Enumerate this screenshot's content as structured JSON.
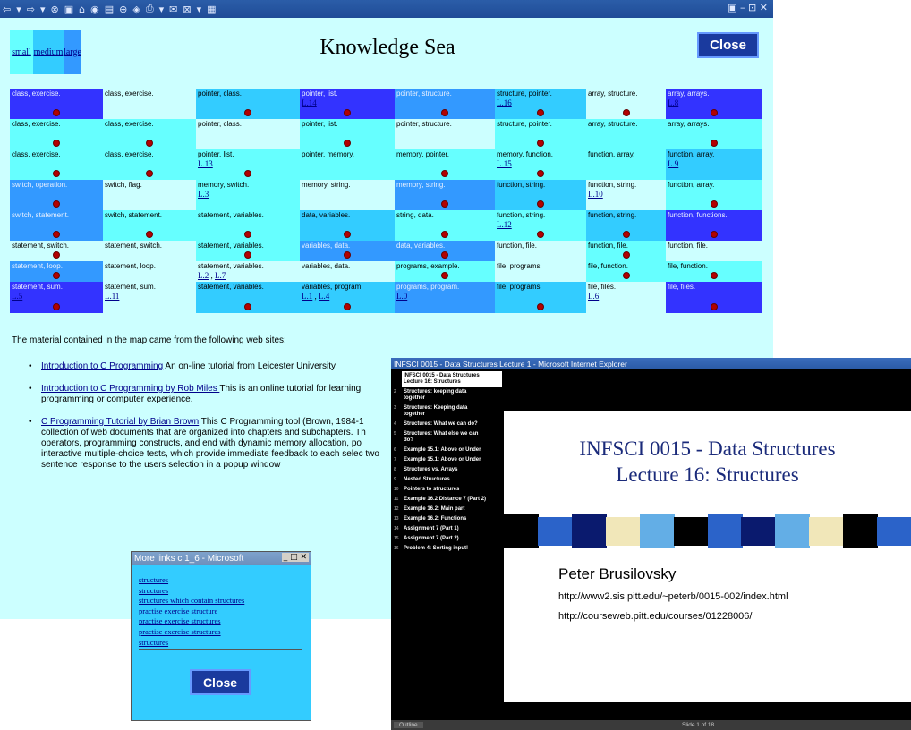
{
  "toolbar_icons": [
    "⇦",
    "▾",
    "⇨",
    "▾",
    "⊗",
    "▣",
    "⌂",
    "◉",
    "▤",
    "⊕",
    "◈",
    "⎙",
    "▾",
    "✉",
    "⊠",
    "▾",
    "▦"
  ],
  "window_buttons": "▣  –  ⊡  ✕",
  "size_links": {
    "small": "small",
    "medium": "medium",
    "large": "large"
  },
  "page_title": "Knowledge Sea",
  "close_label": "Close",
  "grid": {
    "rows": 8,
    "cols": 8,
    "cells": [
      {
        "r": 0,
        "c": 0,
        "label": "class, exercise.",
        "lv": 4,
        "dot": true
      },
      {
        "r": 0,
        "c": 1,
        "label": "class, exercise.",
        "lv": 0,
        "dot": false
      },
      {
        "r": 0,
        "c": 2,
        "label": "pointer, class.",
        "lv": 2,
        "dot": true
      },
      {
        "r": 0,
        "c": 3,
        "label": "pointer, list.",
        "lv": 4,
        "dot": true,
        "links": [
          "L.14"
        ]
      },
      {
        "r": 0,
        "c": 4,
        "label": "pointer, structure.",
        "lv": 3,
        "dot": true
      },
      {
        "r": 0,
        "c": 5,
        "label": "structure, pointer.",
        "lv": 2,
        "dot": true,
        "links": [
          "L.16"
        ]
      },
      {
        "r": 0,
        "c": 6,
        "label": "array, structure.",
        "lv": 0,
        "dot": true
      },
      {
        "r": 0,
        "c": 7,
        "label": "array, arrays.",
        "lv": 4,
        "dot": true,
        "links": [
          "L.8"
        ]
      },
      {
        "r": 1,
        "c": 0,
        "label": "class, exercise.",
        "lv": 1,
        "dot": true
      },
      {
        "r": 1,
        "c": 1,
        "label": "class, exercise.",
        "lv": 1,
        "dot": true
      },
      {
        "r": 1,
        "c": 2,
        "label": "pointer, class.",
        "lv": 0,
        "dot": false
      },
      {
        "r": 1,
        "c": 3,
        "label": "pointer, list.",
        "lv": 1,
        "dot": true
      },
      {
        "r": 1,
        "c": 4,
        "label": "pointer, structure.",
        "lv": 0,
        "dot": false
      },
      {
        "r": 1,
        "c": 5,
        "label": "structure, pointer.",
        "lv": 1,
        "dot": true
      },
      {
        "r": 1,
        "c": 6,
        "label": "array, structure.",
        "lv": 1,
        "dot": false
      },
      {
        "r": 1,
        "c": 7,
        "label": "array, arrays.",
        "lv": 1,
        "dot": true
      },
      {
        "r": 2,
        "c": 0,
        "label": "class, exercise.",
        "lv": 1,
        "dot": true
      },
      {
        "r": 2,
        "c": 1,
        "label": "class, exercise.",
        "lv": 1,
        "dot": true
      },
      {
        "r": 2,
        "c": 2,
        "label": "pointer, list.",
        "lv": 1,
        "dot": true,
        "links": [
          "L.13"
        ]
      },
      {
        "r": 2,
        "c": 3,
        "label": "pointer, memory.",
        "lv": 1,
        "dot": false
      },
      {
        "r": 2,
        "c": 4,
        "label": "memory, pointer.",
        "lv": 1,
        "dot": true
      },
      {
        "r": 2,
        "c": 5,
        "label": "memory, function.",
        "lv": 1,
        "dot": true,
        "links": [
          "L.15"
        ]
      },
      {
        "r": 2,
        "c": 6,
        "label": "function, array.",
        "lv": 1,
        "dot": false
      },
      {
        "r": 2,
        "c": 7,
        "label": "function, array.",
        "lv": 2,
        "dot": false,
        "links": [
          "L.9"
        ]
      },
      {
        "r": 3,
        "c": 0,
        "label": "switch, operation.",
        "lv": 3,
        "dot": true
      },
      {
        "r": 3,
        "c": 1,
        "label": "switch, flag.",
        "lv": 0,
        "dot": false
      },
      {
        "r": 3,
        "c": 2,
        "label": "memory, switch.",
        "lv": 1,
        "dot": false,
        "links": [
          "L.3"
        ]
      },
      {
        "r": 3,
        "c": 3,
        "label": "memory, string.",
        "lv": 0,
        "dot": false
      },
      {
        "r": 3,
        "c": 4,
        "label": "memory, string.",
        "lv": 3,
        "dot": true
      },
      {
        "r": 3,
        "c": 5,
        "label": "function, string.",
        "lv": 2,
        "dot": true
      },
      {
        "r": 3,
        "c": 6,
        "label": "function, string.",
        "lv": 0,
        "dot": false,
        "links": [
          "L.10"
        ]
      },
      {
        "r": 3,
        "c": 7,
        "label": "function, array.",
        "lv": 1,
        "dot": true
      },
      {
        "r": 4,
        "c": 0,
        "label": "switch, statement.",
        "lv": 3,
        "dot": true
      },
      {
        "r": 4,
        "c": 1,
        "label": "switch, statement.",
        "lv": 1,
        "dot": true
      },
      {
        "r": 4,
        "c": 2,
        "label": "statement, variables.",
        "lv": 1,
        "dot": true
      },
      {
        "r": 4,
        "c": 3,
        "label": "data, variables.",
        "lv": 2,
        "dot": true
      },
      {
        "r": 4,
        "c": 4,
        "label": "string, data.",
        "lv": 1,
        "dot": true
      },
      {
        "r": 4,
        "c": 5,
        "label": "function, string.",
        "lv": 1,
        "dot": true,
        "links": [
          "L.12"
        ]
      },
      {
        "r": 4,
        "c": 6,
        "label": "function, string.",
        "lv": 2,
        "dot": true
      },
      {
        "r": 4,
        "c": 7,
        "label": "function, functions.",
        "lv": 4,
        "dot": true
      },
      {
        "r": 5,
        "c": 0,
        "label": "statement, switch.",
        "lv": 0,
        "dot": true
      },
      {
        "r": 5,
        "c": 1,
        "label": "statement, switch.",
        "lv": 0,
        "dot": false
      },
      {
        "r": 5,
        "c": 2,
        "label": "statement, variables.",
        "lv": 1,
        "dot": true
      },
      {
        "r": 5,
        "c": 3,
        "label": "variables, data.",
        "lv": 3,
        "dot": true
      },
      {
        "r": 5,
        "c": 4,
        "label": "data, variables.",
        "lv": 3,
        "dot": true
      },
      {
        "r": 5,
        "c": 5,
        "label": "function, file.",
        "lv": 0,
        "dot": false
      },
      {
        "r": 5,
        "c": 6,
        "label": "function, file.",
        "lv": 1,
        "dot": true
      },
      {
        "r": 5,
        "c": 7,
        "label": "function, file.",
        "lv": 0,
        "dot": false
      },
      {
        "r": 6,
        "c": 0,
        "label": "statement, loop.",
        "lv": 3,
        "dot": true
      },
      {
        "r": 6,
        "c": 1,
        "label": "statement, loop.",
        "lv": 0,
        "dot": false
      },
      {
        "r": 6,
        "c": 2,
        "label": "statement, variables.",
        "lv": 0,
        "dot": false,
        "links": [
          "L.2",
          "L.7"
        ]
      },
      {
        "r": 6,
        "c": 3,
        "label": "variables, data.",
        "lv": 0,
        "dot": false
      },
      {
        "r": 6,
        "c": 4,
        "label": "programs, example.",
        "lv": 1,
        "dot": true
      },
      {
        "r": 6,
        "c": 5,
        "label": "file, programs.",
        "lv": 0,
        "dot": false
      },
      {
        "r": 6,
        "c": 6,
        "label": "file, function.",
        "lv": 1,
        "dot": true
      },
      {
        "r": 6,
        "c": 7,
        "label": "file, function.",
        "lv": 1,
        "dot": true
      },
      {
        "r": 7,
        "c": 0,
        "label": "statement, sum.",
        "lv": 4,
        "dot": true,
        "links": [
          "L.5"
        ]
      },
      {
        "r": 7,
        "c": 1,
        "label": "statement, sum.",
        "lv": 0,
        "dot": false,
        "links": [
          "L.11"
        ]
      },
      {
        "r": 7,
        "c": 2,
        "label": "statement, variables.",
        "lv": 2,
        "dot": true
      },
      {
        "r": 7,
        "c": 3,
        "label": "variables, program.",
        "lv": 2,
        "dot": true,
        "links": [
          "L.1",
          "L.4"
        ]
      },
      {
        "r": 7,
        "c": 4,
        "label": "programs, program.",
        "lv": 3,
        "dot": false,
        "links": [
          "L.0"
        ]
      },
      {
        "r": 7,
        "c": 5,
        "label": "file, programs.",
        "lv": 2,
        "dot": true
      },
      {
        "r": 7,
        "c": 6,
        "label": "file, files.",
        "lv": 0,
        "dot": false,
        "links": [
          "L.6"
        ]
      },
      {
        "r": 7,
        "c": 7,
        "label": "file, files.",
        "lv": 4,
        "dot": true
      }
    ]
  },
  "intro_text": "The material contained in the map came from the following web sites:",
  "sites": [
    {
      "link": "Introduction to C Programming",
      "desc": " An on-line tutorial from Leicester University"
    },
    {
      "link": "Introduction to C Programming by Rob Miles ",
      "desc": "This is an online tutorial for learning programming or computer experience."
    },
    {
      "link": "C Programming Tutorial by Brian Brown",
      "desc": " This C Programming tool (Brown, 1984-1 collection of web documents that are organized into chapters and subchapters. Th operators, programming constructs, and end with dynamic memory allocation, po interactive multiple-choice tests, which provide immediate feedback to each selec two sentence response to the users selection in a popup window"
    }
  ],
  "popup": {
    "title": "More links c 1_6 - Microsoft",
    "controls": "_ □ ✕",
    "links": [
      "structures",
      "structures",
      "structures which contain structures",
      "practise exercise structure",
      "practise exercise structures",
      "practise exercise structures",
      "structures"
    ],
    "close_label": "Close"
  },
  "ie": {
    "title": "INFSCI 0015 - Data Structures Lecture 1 - Microsoft Internet Explorer",
    "outline": [
      {
        "num": "1",
        "text": "INFSCI 0015 - Data Structures Lecture 16: Structures",
        "sel": true
      },
      {
        "num": "2",
        "text": "Structures: keeping data together"
      },
      {
        "num": "3",
        "text": "Structures: Keeping data together"
      },
      {
        "num": "4",
        "text": "Structures: What we can do?"
      },
      {
        "num": "5",
        "text": "Structures: What else we can do?"
      },
      {
        "num": "6",
        "text": "Example 15.1: Above or Under"
      },
      {
        "num": "7",
        "text": "Example 15.1: Above or Under"
      },
      {
        "num": "8",
        "text": "Structures vs. Arrays"
      },
      {
        "num": "9",
        "text": "Nested Structures"
      },
      {
        "num": "10",
        "text": "Pointers to structures"
      },
      {
        "num": "11",
        "text": "Example 16.2 Distance 7 (Part 2)"
      },
      {
        "num": "12",
        "text": "Example 16.2: Main part"
      },
      {
        "num": "13",
        "text": "Example 16.2: Functions"
      },
      {
        "num": "14",
        "text": "Assignment 7 (Part 1)"
      },
      {
        "num": "15",
        "text": "Assignment 7 (Part 2)"
      },
      {
        "num": "16",
        "text": "Problem 4: Sorting input!"
      }
    ],
    "slide_title_line1": "INFSCI 0015 - Data Structures",
    "slide_title_line2": "Lecture 16: Structures",
    "stripe_colors": [
      "#000000",
      "#2b63c9",
      "#0a1a6e",
      "#f1e7b9",
      "#63aee6",
      "#000000",
      "#2b63c9",
      "#0a1a6e",
      "#63aee6",
      "#f1e7b9",
      "#000000",
      "#2b63c9"
    ],
    "author": "Peter Brusilovsky",
    "url1": "http://www2.sis.pitt.edu/~peterb/0015-002/index.html",
    "url2": "http://courseweb.pitt.edu/courses/01228006/",
    "status_outline": "Outline",
    "status_slide": "Slide 1 of 18"
  }
}
